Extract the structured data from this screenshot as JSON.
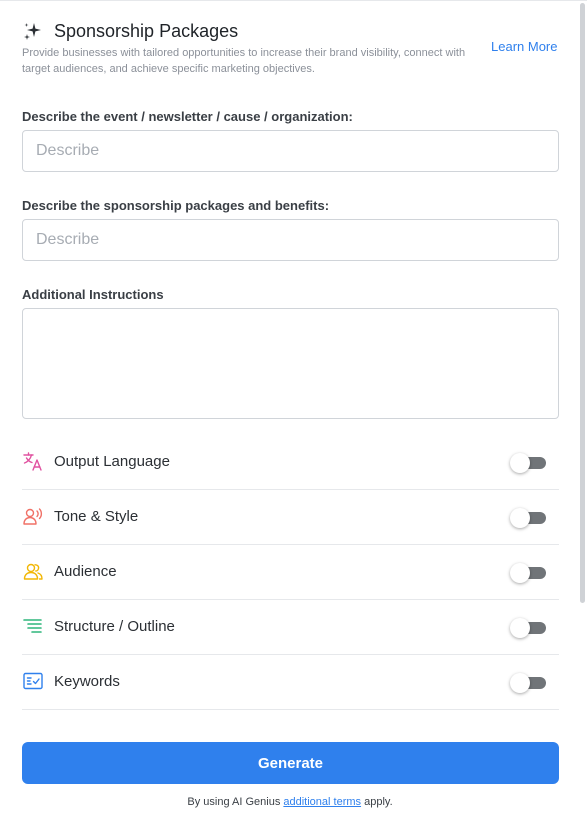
{
  "header": {
    "title": "Sponsorship Packages",
    "subtitle": "Provide businesses with tailored opportunities to increase their brand visibility, connect with target audiences, and achieve specific marketing objectives.",
    "learn_more": "Learn More"
  },
  "fields": {
    "event": {
      "label": "Describe the event / newsletter / cause / organization:",
      "placeholder": "Describe",
      "value": ""
    },
    "packages": {
      "label": "Describe the sponsorship packages and benefits:",
      "placeholder": "Describe",
      "value": ""
    },
    "instructions": {
      "label": "Additional Instructions",
      "value": ""
    }
  },
  "options": [
    {
      "label": "Output Language",
      "icon": "translate-icon",
      "color": "#e052a0",
      "enabled": false
    },
    {
      "label": "Tone & Style",
      "icon": "voice-icon",
      "color": "#f07167",
      "enabled": false
    },
    {
      "label": "Audience",
      "icon": "users-icon",
      "color": "#f2b705",
      "enabled": false
    },
    {
      "label": "Structure / Outline",
      "icon": "list-outline-icon",
      "color": "#2fb67c",
      "enabled": false
    },
    {
      "label": "Keywords",
      "icon": "keywords-icon",
      "color": "#2f80ed",
      "enabled": false
    }
  ],
  "actions": {
    "generate_label": "Generate"
  },
  "footer": {
    "prefix": "By using AI Genius ",
    "link": "additional terms",
    "suffix": " apply."
  },
  "colors": {
    "accent": "#2f80ed",
    "toggle_off": "#707478"
  }
}
